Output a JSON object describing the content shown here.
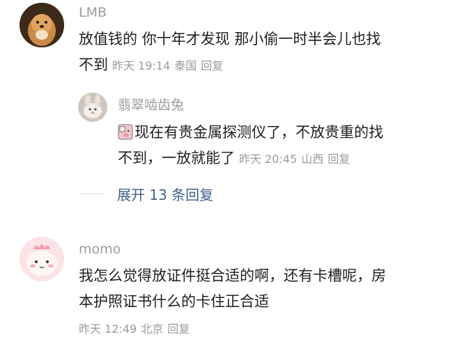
{
  "comments": [
    {
      "user": "LMB",
      "avatar_icon": "dog-avatar-icon",
      "text_line1": "放值钱的 你十年才发现 那小偷一时半会儿也找",
      "text_line2": "不到",
      "time": "昨天 19:14",
      "location": "泰国",
      "reply_label": "回复",
      "reply": {
        "user": "翡翠啮齿兔",
        "avatar_icon": "rabbit-avatar-icon",
        "sticker_icon": "pig-sticker-icon",
        "text_line1": "现在有贵金属探测仪了，不放贵重的找",
        "text_line2": "不到，一放就能了",
        "time": "昨天 20:45",
        "location": "山西",
        "reply_label": "回复"
      },
      "expand_label": "展开 13 条回复"
    },
    {
      "user": "momo",
      "avatar_icon": "pink-character-avatar-icon",
      "text_line1": "我怎么觉得放证件挺合适的啊，还有卡槽呢，房",
      "text_line2": "本护照证书什么的卡住正合适",
      "time": "昨天 12:49",
      "location": "北京",
      "reply_label": "回复"
    }
  ]
}
